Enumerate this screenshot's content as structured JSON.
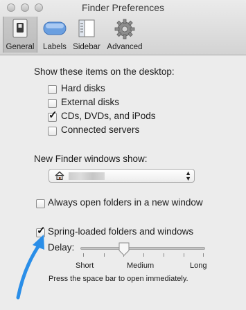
{
  "window": {
    "title": "Finder Preferences"
  },
  "toolbar": {
    "general": "General",
    "labels": "Labels",
    "sidebar": "Sidebar",
    "advanced": "Advanced",
    "selected": "General"
  },
  "desktop": {
    "heading": "Show these items on the desktop:",
    "items": [
      {
        "label": "Hard disks",
        "checked": false
      },
      {
        "label": "External disks",
        "checked": false
      },
      {
        "label": "CDs, DVDs, and iPods",
        "checked": true
      },
      {
        "label": "Connected servers",
        "checked": false
      }
    ]
  },
  "new_window": {
    "heading": "New Finder windows show:",
    "selected_icon": "home-icon"
  },
  "always_open": {
    "label": "Always open folders in a new window",
    "checked": false
  },
  "spring": {
    "label": "Spring-loaded folders and windows",
    "checked": true,
    "delay_label": "Delay:",
    "delay_value": "Medium",
    "short": "Short",
    "medium": "Medium",
    "long": "Long",
    "hint": "Press the space bar to open immediately."
  },
  "colors": {
    "accent_arrow": "#2a8ee8",
    "checkmark": "#111111"
  }
}
